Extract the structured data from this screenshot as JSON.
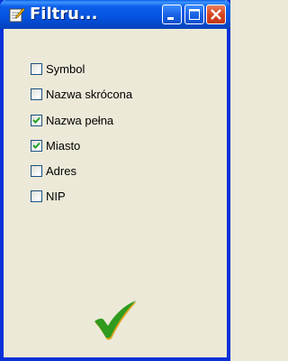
{
  "window": {
    "title": "Filtru...",
    "controls": {
      "minimize_icon": "minimize-icon",
      "maximize_icon": "maximize-icon",
      "close_icon": "close-icon"
    }
  },
  "filters": [
    {
      "label": "Symbol",
      "checked": false
    },
    {
      "label": "Nazwa skrócona",
      "checked": false
    },
    {
      "label": "Nazwa pełna",
      "checked": true
    },
    {
      "label": "Miasto",
      "checked": true
    },
    {
      "label": "Adres",
      "checked": false
    },
    {
      "label": "NIP",
      "checked": false
    }
  ],
  "confirm": {
    "icon": "checkmark-icon"
  },
  "colors": {
    "titlebar": "#0453e0",
    "background": "#ece9d8",
    "check_mark": "#21a121",
    "ok_green": "#2e9b1e",
    "ok_gold": "#d9a21b"
  }
}
